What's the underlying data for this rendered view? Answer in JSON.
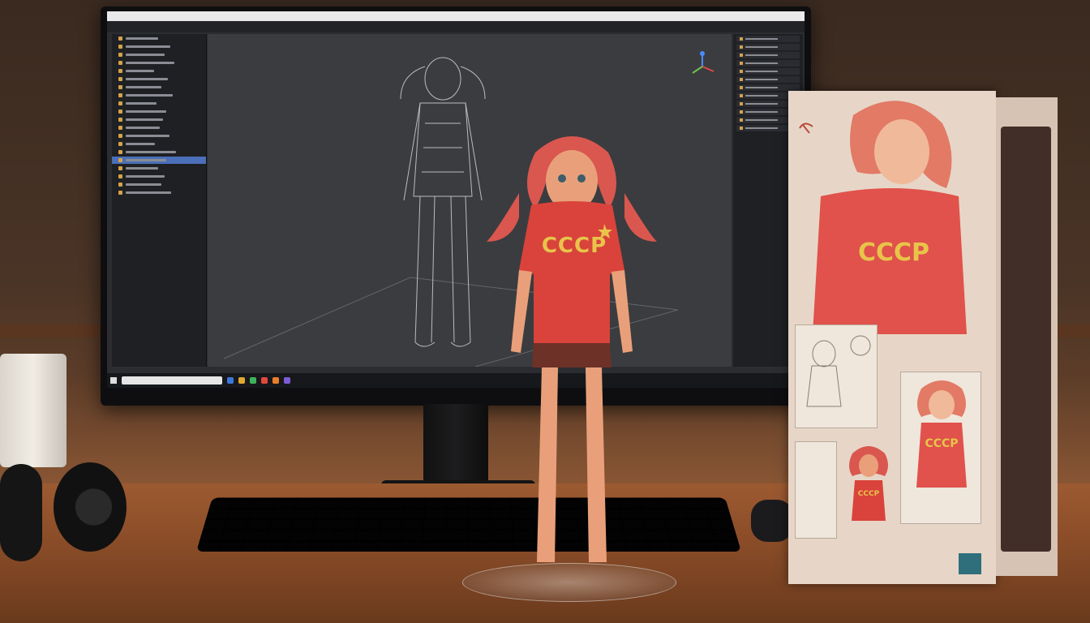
{
  "monitor": {
    "titlebar_text": "",
    "menu_items": [
      "",
      "",
      "",
      "",
      "",
      "",
      "",
      "",
      "",
      "",
      "",
      ""
    ],
    "viewport_label": ""
  },
  "figure": {
    "shirt_text": "CCCP"
  },
  "box": {
    "front_shirt_text": "CCCP",
    "panel_shirt_text_1": "CCCP",
    "panel_shirt_text_2": "CCCP",
    "bottom_text": ""
  },
  "colors": {
    "shirt_red": "#d9433b",
    "shirt_text_gold": "#e8c44a",
    "hair": "#d9574f",
    "skin": "#e9a07a",
    "skirt": "#6d3128",
    "box_bg": "#e7d6c7",
    "screen_bg": "#2b2d31",
    "viewport_bg": "#3b3c3f",
    "selection_blue": "#4b6fb8",
    "box_logo": "#2f6f7b"
  }
}
